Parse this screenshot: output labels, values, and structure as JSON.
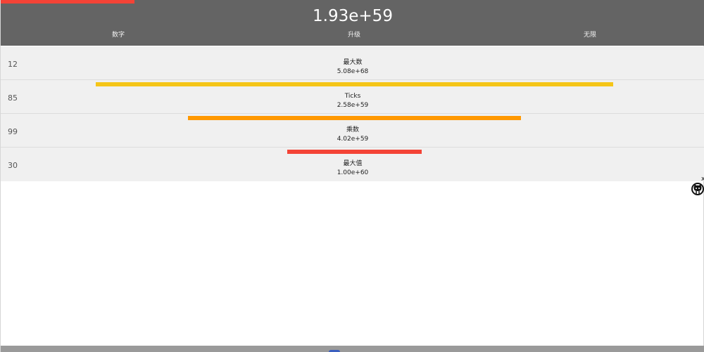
{
  "header": {
    "value": "1.93e+59",
    "progress": 0.19,
    "progress_color": "#f44336",
    "tabs": [
      {
        "label": "数字"
      },
      {
        "label": "升级"
      },
      {
        "label": "无限"
      }
    ]
  },
  "rows": [
    {
      "level": "12",
      "label": "最大数",
      "value": "5.08e+68",
      "bar_color": "#f5c518"
    },
    {
      "level": "85",
      "label": "Ticks",
      "value": "2.58e+59",
      "bar_color": "#ff9800"
    },
    {
      "level": "99",
      "label": "乘数",
      "value": "4.02e+59",
      "bar_color": "#f44336"
    },
    {
      "level": "30",
      "label": "最大值",
      "value": "1.00e+60"
    }
  ],
  "helper": {
    "icon": "octocat-icon",
    "close_label": "x"
  },
  "colors": {
    "header_bg": "#646464",
    "row_bg": "#f0f0f0",
    "footer_bg": "#9a9a9a"
  }
}
